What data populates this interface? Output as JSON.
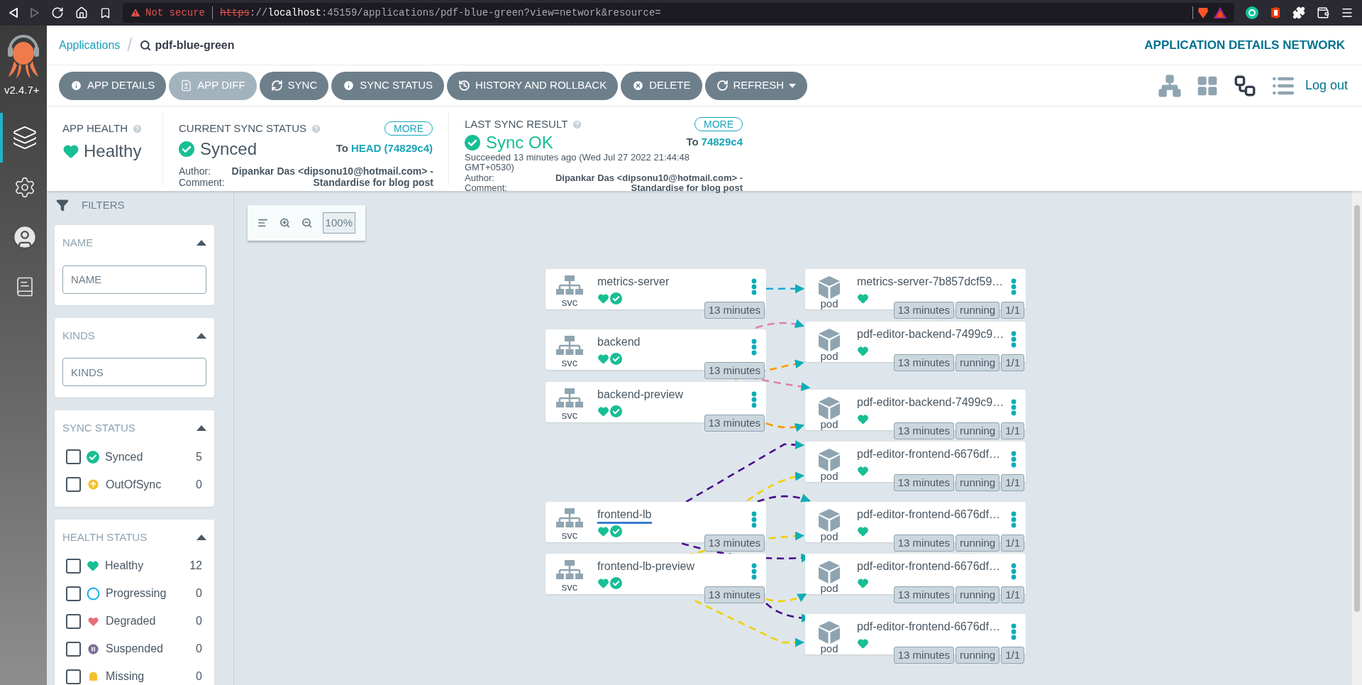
{
  "browser": {
    "security": "Not secure",
    "url": [
      {
        "kind": "scheme",
        "text": "https"
      },
      {
        "kind": "plain",
        "text": "://"
      },
      {
        "kind": "host",
        "text": "localhost"
      },
      {
        "kind": "plain",
        "text": ":45159/applications/pdf-blue-green?view=network&resource="
      }
    ]
  },
  "sidebar": {
    "version": "v2.4.7+",
    "items": [
      {
        "kind": "applications",
        "selected": true
      },
      {
        "kind": "settings",
        "selected": false
      },
      {
        "kind": "user",
        "selected": false
      },
      {
        "kind": "docs",
        "selected": false
      }
    ]
  },
  "header": {
    "breadcrumb": "Applications",
    "separator": "/",
    "app_name": "pdf-blue-green",
    "title": "APPLICATION DETAILS NETWORK"
  },
  "toolbar": {
    "buttons": [
      {
        "kind": "info",
        "label": "APP DETAILS",
        "disabled": false
      },
      {
        "kind": "diff",
        "label": "APP DIFF",
        "disabled": true
      },
      {
        "kind": "sync",
        "label": "SYNC",
        "disabled": false
      },
      {
        "kind": "info",
        "label": "SYNC STATUS",
        "disabled": false
      },
      {
        "kind": "history",
        "label": "HISTORY AND ROLLBACK",
        "disabled": false
      },
      {
        "kind": "delete",
        "label": "DELETE",
        "disabled": false
      },
      {
        "kind": "refresh",
        "label": "REFRESH",
        "disabled": false,
        "dropdown": true
      }
    ],
    "view_modes": [
      {
        "kind": "tree",
        "selected": false
      },
      {
        "kind": "pods",
        "selected": false
      },
      {
        "kind": "network",
        "selected": true
      },
      {
        "kind": "list",
        "selected": false
      }
    ],
    "logout": "Log out"
  },
  "summary": {
    "app_health": {
      "label": "APP HEALTH",
      "status": "Healthy"
    },
    "current_sync": {
      "label": "CURRENT SYNC STATUS",
      "more": "MORE",
      "status": "Synced",
      "to_prefix": "To",
      "revision": "HEAD (74829c4)",
      "author_label": "Author:",
      "author": "Dipankar Das <dipsonu10@hotmail.com> -",
      "comment_label": "Comment:",
      "comment": "Standardise for blog post"
    },
    "last_sync": {
      "label": "LAST SYNC RESULT",
      "more": "MORE",
      "status": "Sync OK",
      "to_prefix": "To",
      "revision": "74829c4",
      "time": "Succeeded 13 minutes ago (Wed Jul 27 2022 21:44:48 GMT+0530)",
      "author_label": "Author:",
      "author": "Dipankar Das <dipsonu10@hotmail.com> -",
      "comment_label": "Comment:",
      "comment": "Standardise for blog post"
    }
  },
  "filters": {
    "title": "FILTERS",
    "sections": [
      {
        "kind": "input",
        "title": "NAME",
        "expanded": true,
        "placeholder": "NAME"
      },
      {
        "kind": "input",
        "title": "KINDS",
        "expanded": true,
        "placeholder": "KINDS"
      },
      {
        "kind": "checklist",
        "title": "SYNC STATUS",
        "expanded": true,
        "items": [
          {
            "kind": "synced",
            "label": "Synced",
            "count": "5",
            "checked": false
          },
          {
            "kind": "outofsync",
            "label": "OutOfSync",
            "count": "0",
            "checked": false
          }
        ]
      },
      {
        "kind": "checklist",
        "title": "HEALTH STATUS",
        "expanded": true,
        "items": [
          {
            "kind": "healthy",
            "label": "Healthy",
            "count": "12",
            "checked": false
          },
          {
            "kind": "progressing",
            "label": "Progressing",
            "count": "0",
            "checked": false
          },
          {
            "kind": "degraded",
            "label": "Degraded",
            "count": "0",
            "checked": false
          },
          {
            "kind": "suspended",
            "label": "Suspended",
            "count": "0",
            "checked": false
          },
          {
            "kind": "missing",
            "label": "Missing",
            "count": "0",
            "checked": false
          }
        ]
      }
    ]
  },
  "graph": {
    "zoom_level": "100%",
    "services": [
      {
        "name": "metrics-server",
        "type": "svc",
        "age": "13 minutes",
        "selected": false
      },
      {
        "name": "backend",
        "type": "svc",
        "age": "13 minutes",
        "selected": false
      },
      {
        "name": "backend-preview",
        "type": "svc",
        "age": "13 minutes",
        "selected": false
      },
      {
        "name": "frontend-lb",
        "type": "svc",
        "age": "13 minutes",
        "selected": true
      },
      {
        "name": "frontend-lb-preview",
        "type": "svc",
        "age": "13 minutes",
        "selected": false
      }
    ],
    "pods": [
      {
        "name": "metrics-server-7b857dcf59…",
        "type": "pod",
        "age": "13 minutes",
        "status": "running",
        "ready": "1/1"
      },
      {
        "name": "pdf-editor-backend-7499c9…",
        "type": "pod",
        "age": "13 minutes",
        "status": "running",
        "ready": "1/1"
      },
      {
        "name": "pdf-editor-backend-7499c9…",
        "type": "pod",
        "age": "13 minutes",
        "status": "running",
        "ready": "1/1"
      },
      {
        "name": "pdf-editor-frontend-6676df…",
        "type": "pod",
        "age": "13 minutes",
        "status": "running",
        "ready": "1/1"
      },
      {
        "name": "pdf-editor-frontend-6676df…",
        "type": "pod",
        "age": "13 minutes",
        "status": "running",
        "ready": "1/1"
      },
      {
        "name": "pdf-editor-frontend-6676df…",
        "type": "pod",
        "age": "13 minutes",
        "status": "running",
        "ready": "1/1"
      },
      {
        "name": "pdf-editor-frontend-6676df…",
        "type": "pod",
        "age": "13 minutes",
        "status": "running",
        "ready": "1/1"
      }
    ]
  }
}
